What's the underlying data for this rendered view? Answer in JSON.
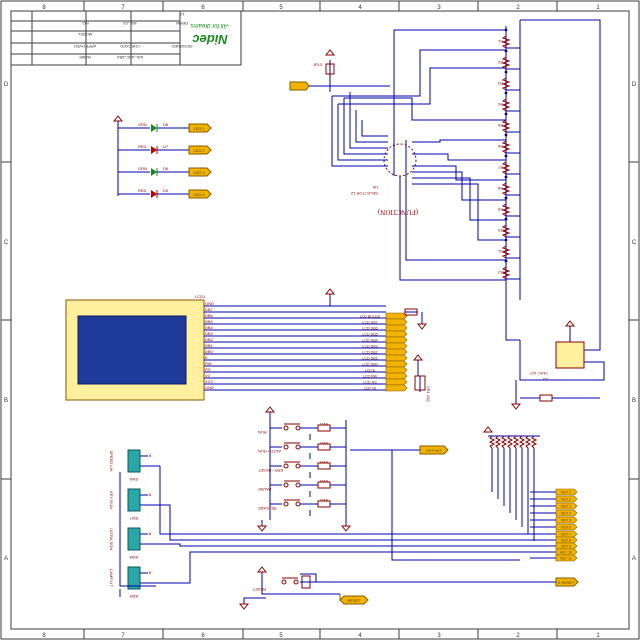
{
  "colors": {
    "background": "#ffffff",
    "frame": "#3c3c3c",
    "wire": "#0000a8",
    "component": "#8b0000",
    "label_fill": "#f0b400",
    "label_text": "#5a3c00",
    "lcd_frame": "#fff0a0",
    "lcd_screen": "#1e3a9a",
    "switch_body": "#2aa6a6",
    "brand_green": "#1d8a1d",
    "junction": "#000080",
    "net_text": "#8b2000"
  },
  "border": {
    "cols_top": [
      "8",
      "7",
      "6",
      "5",
      "4",
      "3",
      "2",
      "1"
    ],
    "cols_bottom": [
      "8",
      "7",
      "6",
      "5",
      "4",
      "3",
      "2",
      "1"
    ],
    "rows": [
      "D",
      "C",
      "B",
      "A"
    ]
  },
  "title_block": {
    "brand": "Nidec",
    "tagline": "-All for dreams",
    "rows": [
      [
        "NAME",
        "ASL-ABC-ABX",
        ""
      ],
      [
        "APPROVED",
        "CHECKED",
        "DESIGNED"
      ],
      [
        "MODEL",
        "",
        ""
      ],
      [
        "NO.",
        "ASL-03",
        "DRAW"
      ],
      [
        "",
        "",
        "1/3"
      ]
    ]
  },
  "leds": [
    {
      "ref": "D8",
      "color": "GRN",
      "net": "LED 1"
    },
    {
      "ref": "D7",
      "color": "RED",
      "net": "LED 2"
    },
    {
      "ref": "D6",
      "color": "GRN",
      "net": "LED 3"
    },
    {
      "ref": "D5",
      "color": "RED",
      "net": "LED 4"
    }
  ],
  "lcd": {
    "ref": "LCD1",
    "pins": [
      "GND",
      "DB7",
      "DB6",
      "DB5",
      "DB4",
      "DB3",
      "DB2",
      "DB1",
      "DB0",
      "E",
      "RW",
      "RS",
      "V0",
      "VCC",
      "GND"
    ],
    "nets": [
      "LCD BL/LED",
      "LCD DB7",
      "LCD DB6",
      "LCD DB5",
      "LCD DB4",
      "LCD DB3",
      "LCD DB2",
      "LCD DB1",
      "LCD DB0",
      "LCD E",
      "LCD RW",
      "LCD RS",
      "LCD V0"
    ],
    "pot": "VR1 10K"
  },
  "selector": {
    "ref": "U6",
    "name": "SELECTOR 12",
    "function_label": "(FUNCTION)",
    "jumper": "JP13"
  },
  "resistors_right": [
    "R1",
    "R2",
    "R3",
    "R4",
    "R5",
    "R6",
    "R7",
    "R8",
    "R9",
    "R10",
    "R11",
    "R12"
  ],
  "buttons": [
    {
      "label": "RUN",
      "ref": "SW1"
    },
    {
      "label": "AUTO / RUN",
      "ref": "SW2"
    },
    {
      "label": "ERR / RESET",
      "ref": "SW3"
    },
    {
      "label": "PAUSE",
      "ref": "SW4"
    },
    {
      "label": "RELEASE",
      "ref": "SW5"
    }
  ],
  "toggles": [
    {
      "label": "SPEED L/H",
      "ref": "SW6"
    },
    {
      "label": "KEY RUN",
      "ref": "SW7"
    },
    {
      "label": "ULTRA SON",
      "ref": "SW8"
    },
    {
      "label": "LAMP LIT",
      "ref": "SW9"
    }
  ],
  "right_nets": [
    "KEY 1",
    "KEY 2",
    "KEY 3",
    "KEY 4",
    "KEY 5",
    "KEY 6",
    "KEY 7",
    "KEY 8",
    "KEY 9",
    "KEY 10",
    "KEY 11"
  ],
  "ic": {
    "ref": "U5",
    "name": "74HC 157"
  },
  "misc_labels": {
    "mid_flag": "KEY INT",
    "reset_sw": "RESET",
    "reset_net": "RESET",
    "right_net": "S RESET"
  }
}
